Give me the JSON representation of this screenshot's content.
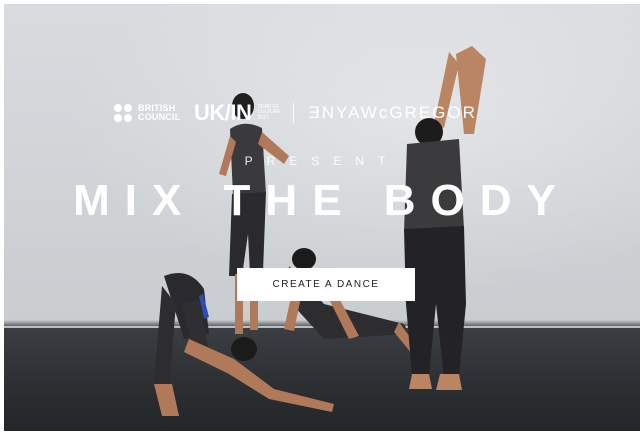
{
  "logos": {
    "british_council": "BRITISH COUNCIL",
    "uk_in": "UK/IN",
    "year_of_culture": "YEAR OF CULTURE 2017",
    "wayne_mcgregor": "ƎNYAWcGREGOR"
  },
  "hero": {
    "present": "PRESENT",
    "title": "MIX THE BODY",
    "cta_label": "CREATE A DANCE"
  }
}
